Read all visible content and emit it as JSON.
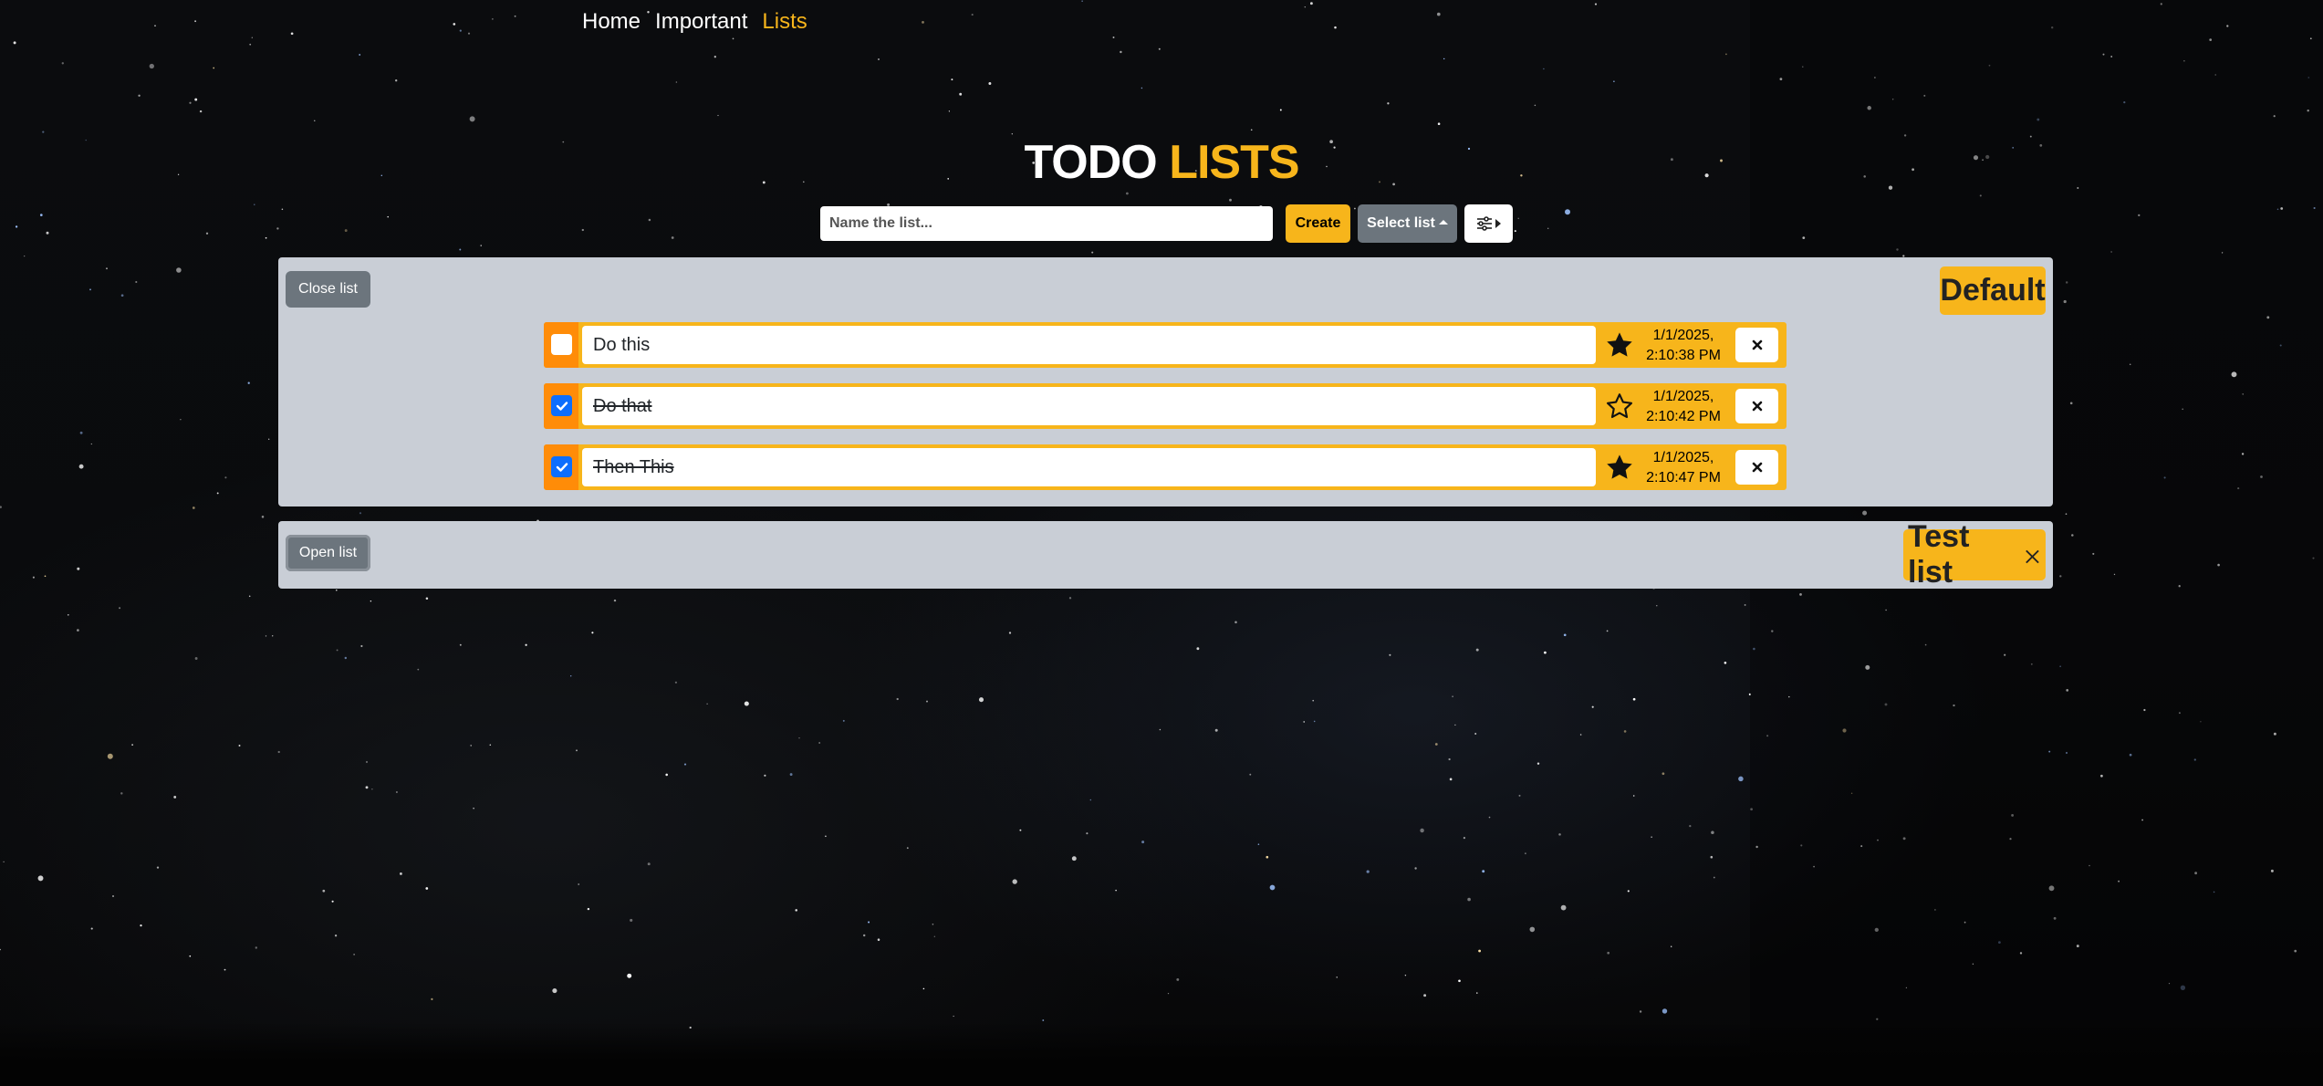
{
  "nav": {
    "home": "Home",
    "important": "Important",
    "lists": "Lists"
  },
  "header": {
    "title_white": "TODO",
    "title_accent": "LISTS"
  },
  "controls": {
    "name_placeholder": "Name the list...",
    "create_label": "Create",
    "select_label": "Select list",
    "settings_icon": "sliders-icon"
  },
  "lists": [
    {
      "name": "Default",
      "toggle_label": "Close list",
      "expanded": true,
      "todos": [
        {
          "text": "Do this",
          "completed": false,
          "important": true,
          "date": "1/1/2025,",
          "time": "2:10:38 PM"
        },
        {
          "text": "Do that",
          "completed": true,
          "important": false,
          "date": "1/1/2025,",
          "time": "2:10:42 PM"
        },
        {
          "text": "Then This",
          "completed": true,
          "important": true,
          "date": "1/1/2025,",
          "time": "2:10:47 PM"
        }
      ]
    },
    {
      "name": "Test list",
      "toggle_label": "Open list",
      "expanded": false,
      "todos": []
    }
  ],
  "colors": {
    "accent": "#f7b51b",
    "orange": "#ff8c08",
    "panel": "#c9ced6",
    "gray_button": "#6c757d",
    "checkbox_checked": "#0d6efd"
  }
}
